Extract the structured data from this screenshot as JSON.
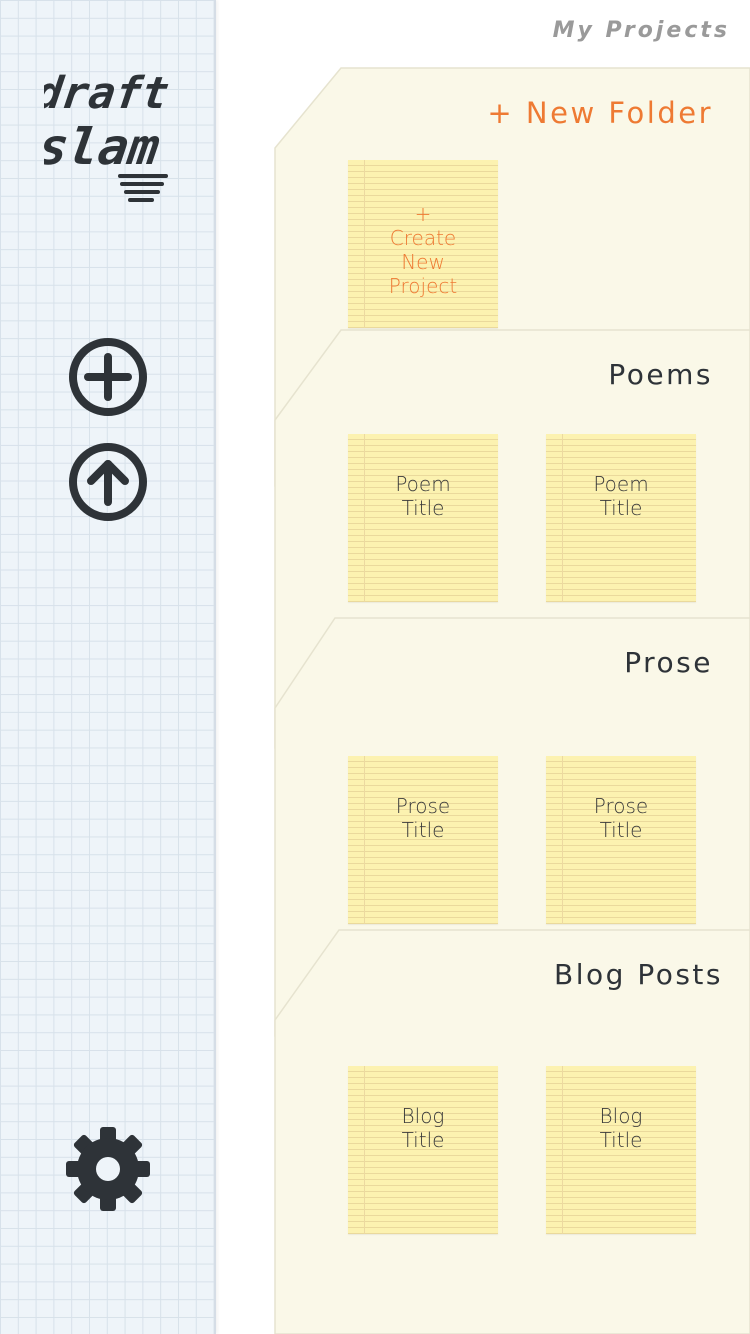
{
  "header": {
    "title": "My Projects"
  },
  "logo": {
    "line1": "draft",
    "line2": "slam"
  },
  "sidebar": {
    "add_icon": "plus-circle-icon",
    "upload_icon": "arrow-up-circle-icon",
    "settings_icon": "gear-icon"
  },
  "colors": {
    "accent": "#ee7a33",
    "folder_bg": "#faf8e8",
    "note_bg": "#fcf2b0",
    "icon": "#2e3338"
  },
  "folders": [
    {
      "title": "+ New Folder",
      "notes": [
        "+\nCreate\nNew\nProject"
      ]
    },
    {
      "title": "Poems",
      "notes": [
        "Poem\nTitle",
        "Poem\nTitle"
      ]
    },
    {
      "title": "Prose",
      "notes": [
        "Prose\nTitle",
        "Prose\nTitle"
      ]
    },
    {
      "title": "Blog Posts",
      "notes": [
        "Blog\nTitle",
        "Blog\nTitle"
      ]
    }
  ]
}
